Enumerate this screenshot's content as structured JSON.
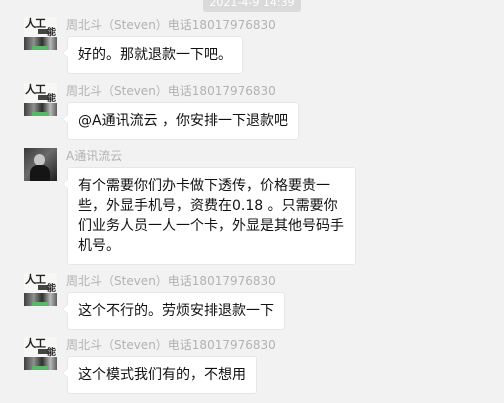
{
  "timestamp": "2021-4-9 14:39",
  "messages": [
    {
      "sender": "周北斗（Steven）电话18017976830",
      "text": "好的。那就退款一下吧。",
      "avatar": "ai-logo-avatar"
    },
    {
      "sender": "周北斗（Steven）电话18017976830",
      "text": "@A通讯流云 ，你安排一下退款吧",
      "avatar": "ai-logo-avatar"
    },
    {
      "sender": "A通讯流云",
      "text": "有个需要你们办卡做下透传，价格要贵一些，外显手机号，资费在0.18 。只需要你们业务人员一人一个卡，外显是其他号码手机号。",
      "avatar": "photo-avatar"
    },
    {
      "sender": "周北斗（Steven）电话18017976830",
      "text": "这个不行的。劳烦安排退款一下",
      "avatar": "ai-logo-avatar"
    },
    {
      "sender": "周北斗（Steven）电话18017976830",
      "text": "这个模式我们有的，不想用",
      "avatar": "ai-logo-avatar"
    }
  ],
  "avatar_logo": {
    "line1": "人工",
    "line2": "能"
  }
}
